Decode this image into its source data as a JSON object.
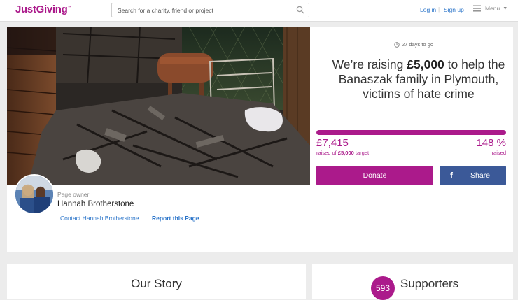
{
  "header": {
    "logo": "JustGiving",
    "logo_mark": "™",
    "search_placeholder": "Search for a charity, friend or project",
    "login": "Log in",
    "separator": "|",
    "signup": "Sign up",
    "menu": "Menu"
  },
  "page": {
    "days_left": "27 days to go",
    "headline_prefix": "We’re raising ",
    "headline_amount": "£5,000",
    "headline_suffix": " to help the Banaszak family in Plymouth, victims of hate crime",
    "raised_amount": "£7,415",
    "raised_target_prefix": "raised of ",
    "raised_target_amount": "£5,000",
    "raised_target_suffix": " target",
    "raised_percent": "148 %",
    "raised_percent_label": "raised",
    "progress_fraction": 1.0,
    "donate": "Donate",
    "share": "Share",
    "facebook_glyph": "f"
  },
  "owner": {
    "role": "Page owner",
    "name": "Hannah Brotherstone",
    "contact": "Contact Hannah Brotherstone",
    "report": "Report this Page"
  },
  "sections": {
    "story_title": "Our Story",
    "supporters_count": "593",
    "supporters_label": "Supporters"
  },
  "colors": {
    "brand_purple": "#ab1a8b",
    "facebook_blue": "#3b5998",
    "link_blue": "#2a74c9",
    "page_bg": "#ececec"
  },
  "icons": {
    "search": "search-icon",
    "menu": "hamburger-menu-icon",
    "caret": "caret-down-icon",
    "clock": "clock-icon",
    "facebook": "facebook-icon"
  }
}
